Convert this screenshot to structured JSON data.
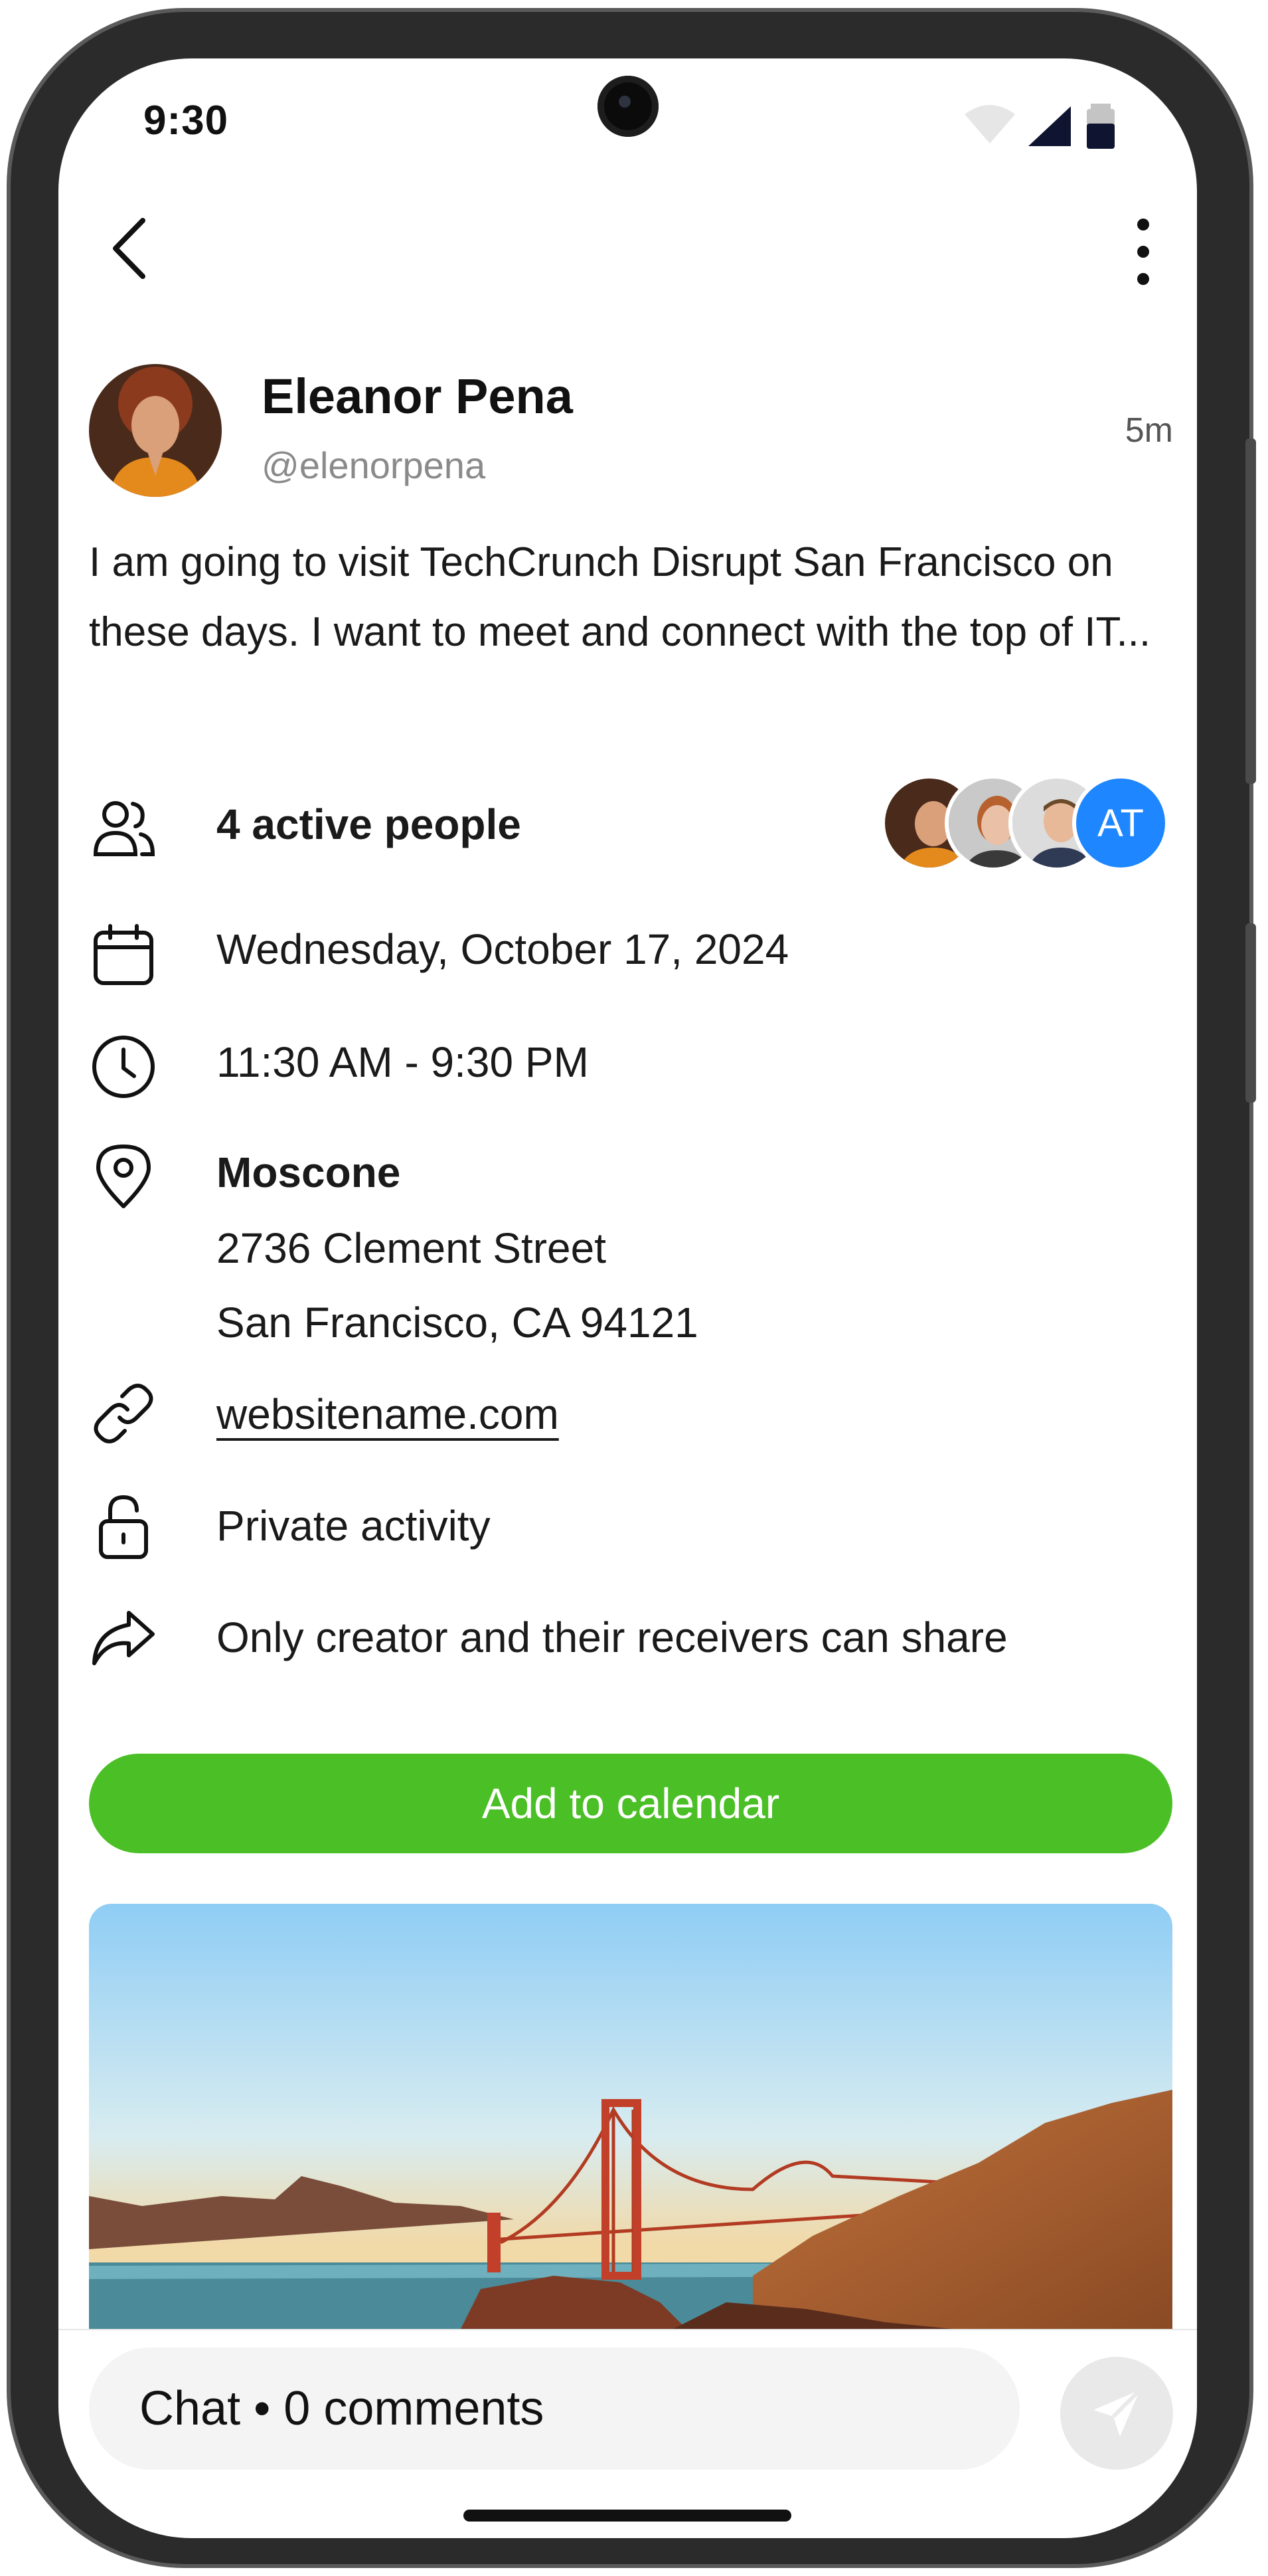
{
  "status_bar": {
    "time": "9:30"
  },
  "author": {
    "name": "Eleanor Pena",
    "handle": "@elenorpena",
    "time_ago": "5m"
  },
  "post": {
    "text": "I am going to visit TechCrunch Disrupt San Francisco on these days. I want to meet and connect with the top of IT..."
  },
  "details": {
    "attendees": {
      "label": "4 active people",
      "extra_initials": "AT"
    },
    "date": "Wednesday, October 17, 2024",
    "time": "11:30 AM - 9:30 PM",
    "location": {
      "name": "Moscone",
      "street": "2736 Clement Street",
      "city": "San Francisco, CA 94121"
    },
    "website": "websitename.com",
    "privacy": "Private activity",
    "sharing": "Only creator and their receivers can share"
  },
  "actions": {
    "add_to_calendar": "Add to calendar"
  },
  "chat": {
    "placeholder": "Chat • 0 comments"
  },
  "colors": {
    "accent_green": "#4BBF26",
    "avatar_blue": "#1E86FF",
    "muted": "#8A8A8A"
  },
  "icons": [
    "back-icon",
    "more-vertical-icon",
    "people-icon",
    "calendar-icon",
    "clock-icon",
    "location-pin-icon",
    "link-icon",
    "lock-icon",
    "share-icon",
    "send-icon"
  ]
}
